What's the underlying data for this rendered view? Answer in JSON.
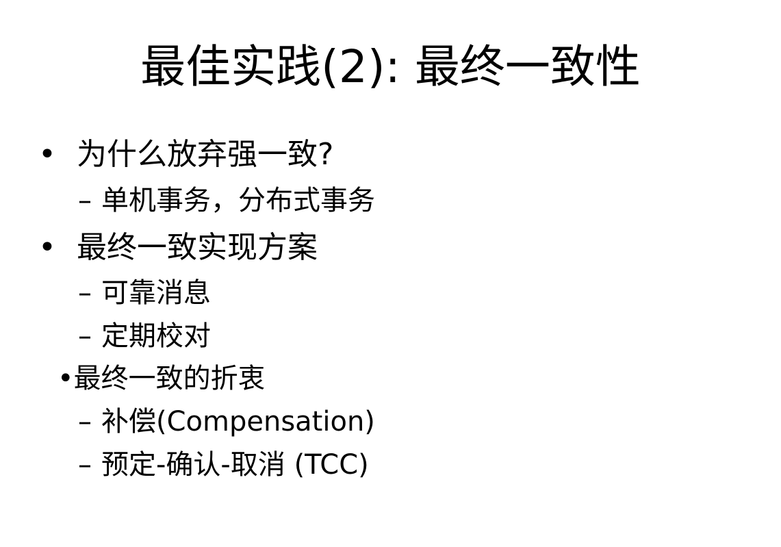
{
  "slide": {
    "title": "最佳实践(2): 最终一致性",
    "items": [
      {
        "bullet": "•",
        "text": "为什么放弃强一致?",
        "subitems": [
          {
            "dash": "–",
            "text": "单机事务，分布式事务"
          }
        ]
      },
      {
        "bullet": "•",
        "text": "最终一致实现方案",
        "subitems": [
          {
            "dash": "–",
            "text": "可靠消息"
          },
          {
            "dash": "–",
            "text": "定期校对"
          }
        ]
      },
      {
        "bullet": "•",
        "text": "最终一致的折衷",
        "subitems": [
          {
            "dash": "–",
            "text": "补偿(Compensation)"
          },
          {
            "dash": "–",
            "text": "预定-确认-取消 (TCC)"
          }
        ]
      }
    ]
  }
}
